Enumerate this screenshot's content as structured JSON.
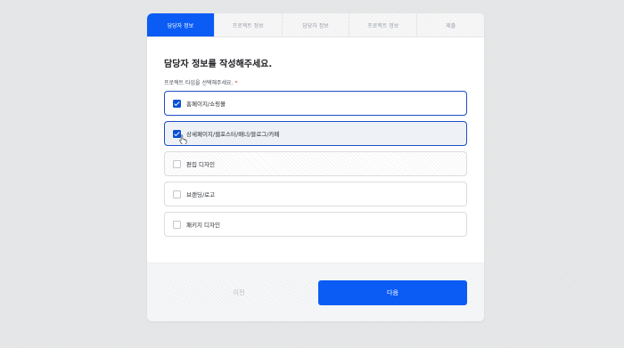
{
  "tabs": [
    {
      "label": "담당자 정보",
      "active": true
    },
    {
      "label": "프로젝트 정보",
      "active": false
    },
    {
      "label": "담당자 정보",
      "active": false
    },
    {
      "label": "프로젝트 정보",
      "active": false
    },
    {
      "label": "제출",
      "active": false
    }
  ],
  "form": {
    "title": "담당자 정보를 작성해주세요.",
    "field_label": "프로젝트 타입을 선택해주세요.",
    "required_mark": "*",
    "options": [
      {
        "label": "홈페이지/쇼핑몰",
        "checked": true
      },
      {
        "label": "상세페이지/웹포스터/배너/블로그/카페",
        "checked": true
      },
      {
        "label": "편집 디자인",
        "checked": false
      },
      {
        "label": "브랜딩/로고",
        "checked": false
      },
      {
        "label": "패키지 디자인",
        "checked": false
      }
    ]
  },
  "buttons": {
    "prev_label": "이전",
    "next_label": "다음"
  },
  "colors": {
    "accent": "#0a5cf5",
    "checkbox": "#0a4fd6",
    "background": "#e3e4e5"
  },
  "icons": {
    "cursor": "hand-pointer-icon",
    "check": "checkmark-icon"
  }
}
